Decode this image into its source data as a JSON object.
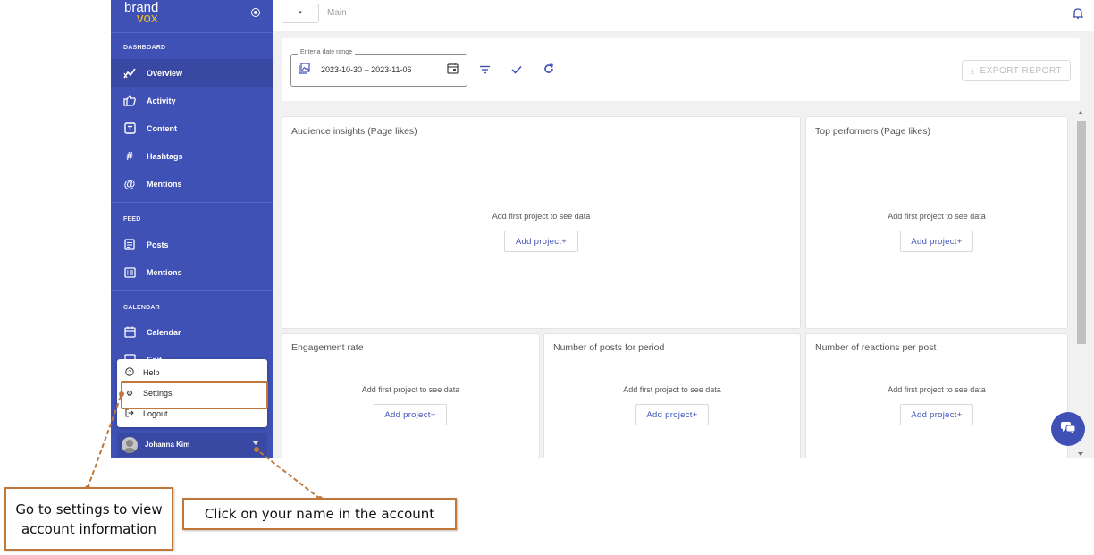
{
  "sidebar": {
    "logo_top": "brand",
    "logo_bottom": "vox",
    "sections": [
      "DASHBOARD",
      "FEED",
      "CALENDAR"
    ],
    "dashboard_items": [
      {
        "label": "Overview",
        "icon": "chart-icon"
      },
      {
        "label": "Activity",
        "icon": "thumb-up-icon"
      },
      {
        "label": "Content",
        "icon": "content-icon"
      },
      {
        "label": "Hashtags",
        "icon": "hashtag-icon"
      },
      {
        "label": "Mentions",
        "icon": "at-icon"
      }
    ],
    "feed_items": [
      {
        "label": "Posts",
        "icon": "posts-icon"
      },
      {
        "label": "Mentions",
        "icon": "list-icon"
      }
    ],
    "calendar_items": [
      {
        "label": "Calendar",
        "icon": "calendar-icon"
      },
      {
        "label": "Edit",
        "icon": "edit-icon"
      }
    ],
    "user_menu": [
      {
        "label": "Help",
        "icon": "help-icon"
      },
      {
        "label": "Settings",
        "icon": "gear-icon"
      },
      {
        "label": "Logout",
        "icon": "logout-icon"
      }
    ],
    "user_name": "Johanna Kim",
    "accent": "#3f51b5"
  },
  "topbar": {
    "select_value": "▾",
    "breadcrumb": "Main"
  },
  "toolbar": {
    "date_label": "Enter a date range",
    "date_start": "2023-10-30",
    "date_separator": "–",
    "date_end": "2023-11-06",
    "export_label": "EXPORT REPORT"
  },
  "cards": [
    {
      "title": "Audience insights (Page likes)",
      "message": "Add first project to see data",
      "button": "Add project+"
    },
    {
      "title": "Top performers (Page likes)",
      "message": "Add first project to see data",
      "button": "Add project+"
    },
    {
      "title": "Engagement rate",
      "message": "Add first project to see data",
      "button": "Add project+"
    },
    {
      "title": "Number of posts for period",
      "message": "Add first project to see data",
      "button": "Add project+"
    },
    {
      "title": "Number of reactions per post",
      "message": "Add first project to see data",
      "button": "Add project+"
    }
  ],
  "annotations": {
    "settings_note": "Go to settings to view account information",
    "name_note": "Click on your name in the account",
    "color": "#c0773a"
  }
}
